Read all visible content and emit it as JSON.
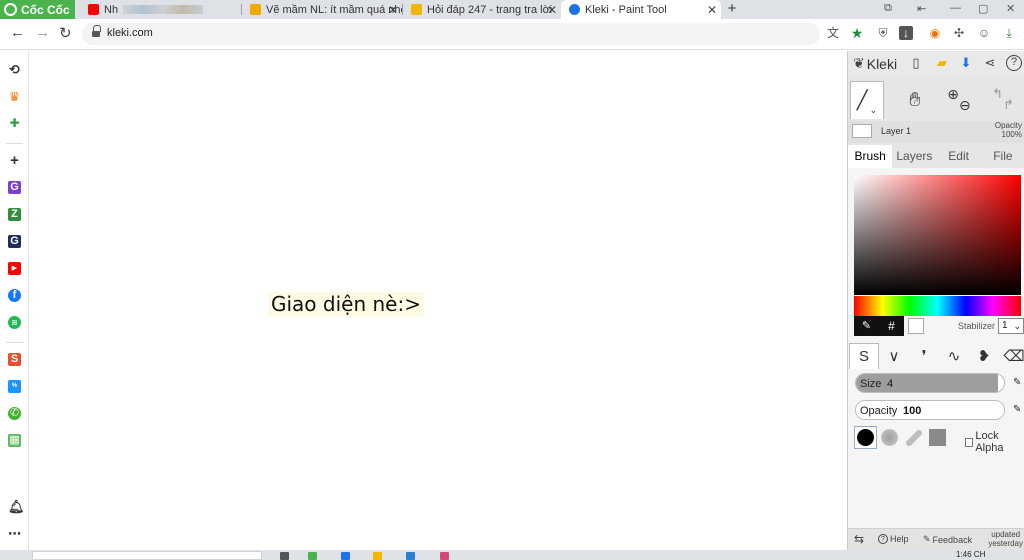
{
  "browser": {
    "brand": "Cốc Cốc",
    "tabs": [
      {
        "title": "Nh",
        "favicon": "youtube-icon",
        "color": "#ff0000"
      },
      {
        "title": "Vẽ mầm NL: ít mầm quá nhé",
        "favicon": "generic-page-icon",
        "color": "#f2a900"
      },
      {
        "title": "Hỏi đáp 247 - trang tra lời",
        "favicon": "hoidap247-icon",
        "color": "#f4b400"
      },
      {
        "title": "Kleki - Paint Tool",
        "favicon": "kleki-icon",
        "color": "#1a73e8"
      }
    ],
    "new_tab": "+",
    "url": "kleki.com"
  },
  "canvas": {
    "text": "Giao diện nè:>"
  },
  "kleki": {
    "logo": "Kleki",
    "layer": {
      "name": "Layer 1",
      "opacity_label": "Opacity",
      "opacity_value": "100%"
    },
    "tabs": [
      "Brush",
      "Layers",
      "Edit",
      "File"
    ],
    "hex_label": "#",
    "stabilizer_label": "Stabilizer",
    "stabilizer_value": "1",
    "size_label": "Size",
    "size_value": "4",
    "size_fraction": 0.96,
    "opacity_label": "Opacity",
    "opacity_value": "100",
    "opacity_fraction": 1.0,
    "lock_alpha_label": "Lock Alpha",
    "footer": {
      "help": "Help",
      "feedback": "Feedback",
      "updated_line1": "updated",
      "updated_line2": "yesterday"
    }
  },
  "taskbar": {
    "clock": "1:46 CH"
  }
}
